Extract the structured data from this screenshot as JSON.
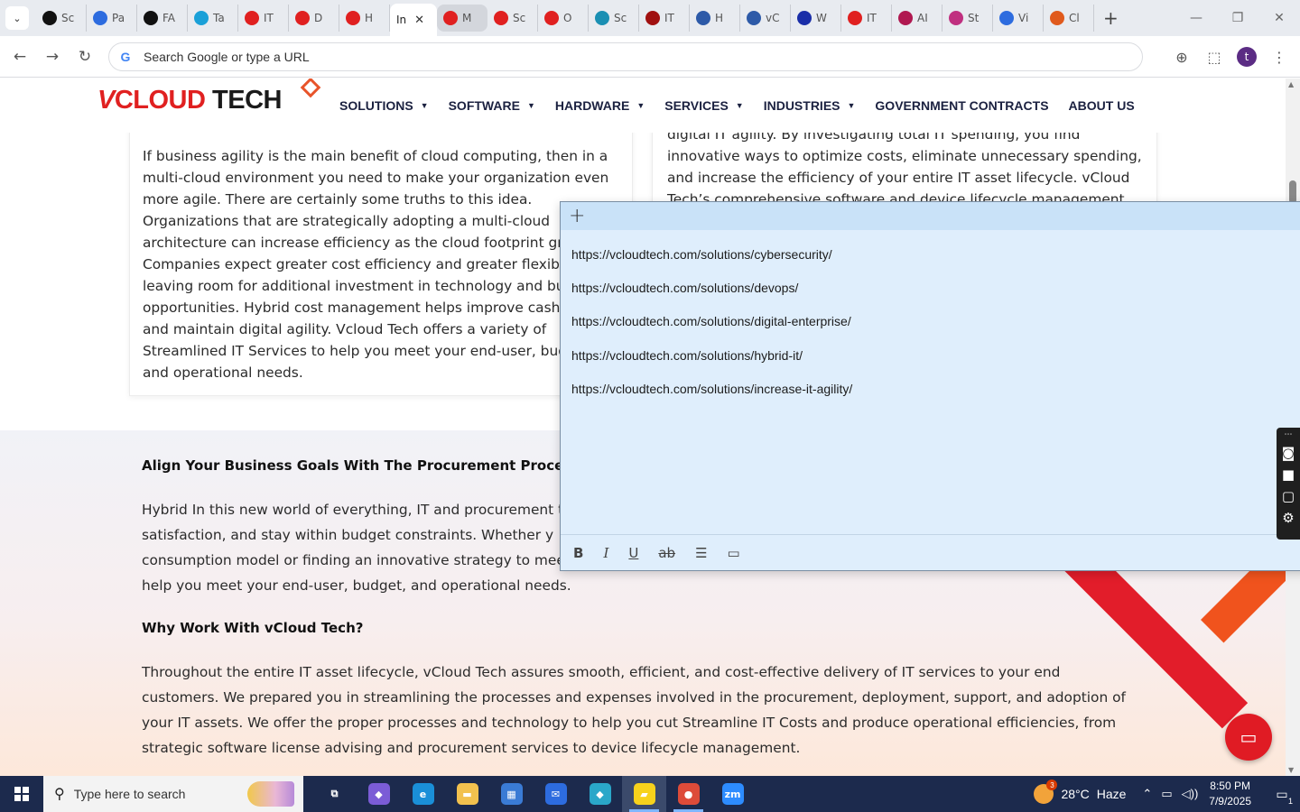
{
  "browser": {
    "tabs": [
      {
        "label": "Sc",
        "icon": "github-icon",
        "color": "#111111"
      },
      {
        "label": "Pa",
        "icon": "speed-icon",
        "color": "#2d6cdf"
      },
      {
        "label": "FA",
        "icon": "openai-icon",
        "color": "#111111"
      },
      {
        "label": "Ta",
        "icon": "tawk-icon",
        "color": "#1aa0d8"
      },
      {
        "label": "IT",
        "icon": "vcloud-icon",
        "color": "#e02020"
      },
      {
        "label": "D",
        "icon": "vcloud-icon",
        "color": "#e02020"
      },
      {
        "label": "H",
        "icon": "vcloud-icon",
        "color": "#e02020"
      },
      {
        "label": "In",
        "icon": "page-icon",
        "color": "#ffffff",
        "active": true
      },
      {
        "label": "M",
        "icon": "vcloud-icon",
        "color": "#e02020",
        "highlight": true
      },
      {
        "label": "Sc",
        "icon": "vcloud-icon",
        "color": "#e02020"
      },
      {
        "label": "O",
        "icon": "vcloud-icon",
        "color": "#e02020"
      },
      {
        "label": "Sc",
        "icon": "cog-icon",
        "color": "#1a8fb3"
      },
      {
        "label": "IT",
        "icon": "v-icon",
        "color": "#a01010"
      },
      {
        "label": "H",
        "icon": "balance-icon",
        "color": "#2d5aa8"
      },
      {
        "label": "vC",
        "icon": "check-icon",
        "color": "#2d5aa8"
      },
      {
        "label": "W",
        "icon": "x-icon",
        "color": "#1a2ea8"
      },
      {
        "label": "IT",
        "icon": "vcloud-icon",
        "color": "#e02020"
      },
      {
        "label": "AI",
        "icon": "ai-icon",
        "color": "#b01850"
      },
      {
        "label": "St",
        "icon": "pen-icon",
        "color": "#c03080"
      },
      {
        "label": "Vi",
        "icon": "pulse-icon",
        "color": "#2d6cdf"
      },
      {
        "label": "Cl",
        "icon": "claude-icon",
        "color": "#e05a1d"
      }
    ],
    "tab_close": "✕",
    "new_tab": "+",
    "window_controls": {
      "minimize": "—",
      "restore": "❐",
      "close": "✕"
    },
    "omnibox_placeholder": "Search Google or type a URL",
    "nav": {
      "back": "←",
      "forward": "→",
      "reload": "↻"
    },
    "avatar_letter": "t"
  },
  "site": {
    "logo": {
      "v": "V",
      "cloud": "CLOUD",
      "tech": " TECH"
    },
    "nav_items": [
      {
        "label": "SOLUTIONS",
        "caret": true
      },
      {
        "label": "SOFTWARE",
        "caret": true
      },
      {
        "label": "HARDWARE",
        "caret": true
      },
      {
        "label": "SERVICES",
        "caret": true
      },
      {
        "label": "INDUSTRIES",
        "caret": true
      },
      {
        "label": "GOVERNMENT CONTRACTS",
        "caret": false
      },
      {
        "label": "ABOUT US",
        "caret": false
      }
    ],
    "card_left_text": "If business agility is the main benefit of cloud computing, then in a multi-cloud environment you need to make your organization even more agile. There are certainly some truths to this idea. Organizations that are strategically adopting a multi-cloud architecture can increase efficiency as the cloud footprint grows. Companies expect greater cost efficiency and greater flexibility, leaving room for additional investment in technology and business opportunities. Hybrid cost management helps improve cash flow and maintain digital agility. Vcloud Tech offers a variety of Streamlined IT Services to help you meet your end-user, budget, and operational needs.",
    "card_right_text": "digital IT agility. By investigating total IT spending, you find innovative ways to optimize costs, eliminate unnecessary spending, and increase the efficiency of your entire IT asset lifecycle. vCloud Tech’s comprehensive software and device lifecycle management",
    "section1_heading": "Align Your Business Goals With The Procurement Process To",
    "section1_text": "Hybrid In this new world of everything, IT and procurement t satisfaction, and stay within budget constraints. Whether y consumption model or finding an innovative strategy to mee help you meet your end-user, budget, and operational needs.",
    "section2_heading": "Why Work With vCloud Tech?",
    "section2_text": "Throughout the entire IT asset lifecycle, vCloud Tech assures smooth, efficient, and cost-effective delivery of IT services to your end customers. We prepared you in streamlining the processes and expenses involved in the procurement, deployment, support, and adoption of your IT assets. We offer the proper processes and technology to help you cut Streamline IT Costs and produce operational efficiencies, from strategic software license advising and procurement services to device lifecycle management.",
    "brand_red": "#e02020",
    "ribbon_orange": "#f0531d"
  },
  "sticky_note": {
    "add_label": "+",
    "links": [
      "https://vcloudtech.com/solutions/cybersecurity/",
      "https://vcloudtech.com/solutions/devops/",
      "https://vcloudtech.com/solutions/digital-enterprise/",
      "https://vcloudtech.com/solutions/hybrid-it/",
      "https://vcloudtech.com/solutions/increase-it-agility/"
    ],
    "format": {
      "bold": "B",
      "italic": "I",
      "underline": "U",
      "strike": "ab",
      "list": "☰",
      "image": "▭"
    },
    "background": "#dfeefc"
  },
  "side_tools": [
    "screenshot-icon",
    "camera-icon",
    "video-icon",
    "window-icon",
    "settings-icon"
  ],
  "taskbar": {
    "search_placeholder": "Type here to search",
    "apps": [
      {
        "name": "task-view-icon",
        "glyph": "⧉",
        "color": "transparent"
      },
      {
        "name": "copilot-icon",
        "glyph": "◆",
        "color": "#7b5cd6"
      },
      {
        "name": "edge-icon",
        "glyph": "e",
        "color": "#1a8fd8"
      },
      {
        "name": "file-explorer-icon",
        "glyph": "▬",
        "color": "#f2c14e"
      },
      {
        "name": "store-icon",
        "glyph": "▦",
        "color": "#3a7bd5"
      },
      {
        "name": "mail-icon",
        "glyph": "✉",
        "color": "#2d6cdf"
      },
      {
        "name": "app-diamond-icon",
        "glyph": "◆",
        "color": "#2aa7c9"
      },
      {
        "name": "sticky-notes-icon",
        "glyph": "▰",
        "color": "#f7d21c",
        "focused": true
      },
      {
        "name": "chrome-icon",
        "glyph": "●",
        "color": "#dd4b39",
        "active": true
      },
      {
        "name": "zoom-icon",
        "glyph": "zm",
        "color": "#2d8cff"
      }
    ],
    "weather": {
      "temp": "28°C",
      "condition": "Haze",
      "badge": "3"
    },
    "time": "8:50 PM",
    "date": "7/9/2025",
    "notification_count": "1"
  }
}
